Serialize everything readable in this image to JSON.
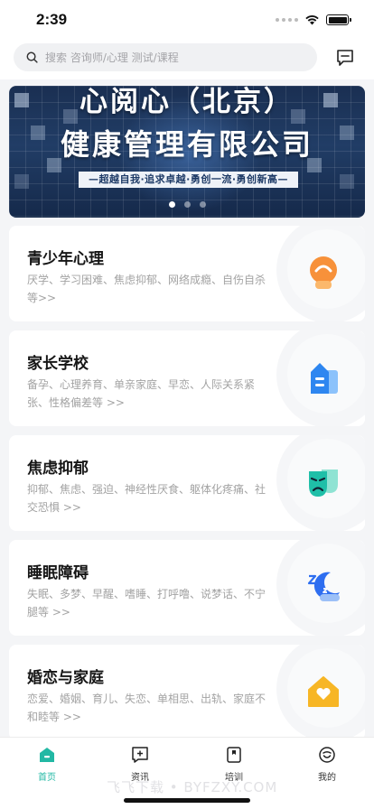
{
  "status_bar": {
    "time": "2:39"
  },
  "search": {
    "placeholder": "搜索 咨询师/心理 测试/课程"
  },
  "banner": {
    "title_line1": "心阅心（北京）",
    "title_line2": "健康管理有限公司",
    "slogan": "—超越自我·追求卓越·勇创一流·勇创新高—",
    "dots": 3,
    "active_dot": 0
  },
  "categories": [
    {
      "title": "青少年心理",
      "desc": "厌学、学习困难、焦虑抑郁、网络成瘾、自伤自杀等>>",
      "icon": "teen-face-icon",
      "color": "#f7913a"
    },
    {
      "title": "家长学校",
      "desc": "备孕、心理养育、单亲家庭、早恋、人际关系紧张、性格偏差等 >>",
      "icon": "school-building-icon",
      "color": "#2e86f0"
    },
    {
      "title": "焦虑抑郁",
      "desc": "抑郁、焦虑、强迫、神经性厌食、躯体化疼痛、社交恐惧 >>",
      "icon": "drama-mask-icon",
      "color": "#1fbfa8"
    },
    {
      "title": "睡眠障碍",
      "desc": "失眠、多梦、早醒、嗜睡、打呼噜、说梦话、不宁腿等 >>",
      "icon": "moon-sleep-icon",
      "color": "#2e6ef0"
    },
    {
      "title": "婚恋与家庭",
      "desc": "恋爱、婚姻、育儿、失恋、单相思、出轨、家庭不和睦等 >>",
      "icon": "house-heart-icon",
      "color": "#f7b625"
    }
  ],
  "tabbar": {
    "items": [
      {
        "label": "首页",
        "icon": "home-icon",
        "active": true
      },
      {
        "label": "资讯",
        "icon": "news-icon",
        "active": false
      },
      {
        "label": "培训",
        "icon": "training-icon",
        "active": false
      },
      {
        "label": "我的",
        "icon": "profile-icon",
        "active": false
      }
    ],
    "watermark": "飞飞下载 • BYFZXY.COM"
  },
  "colors": {
    "accent": "#22b8a4",
    "background": "#f4f5f7"
  }
}
